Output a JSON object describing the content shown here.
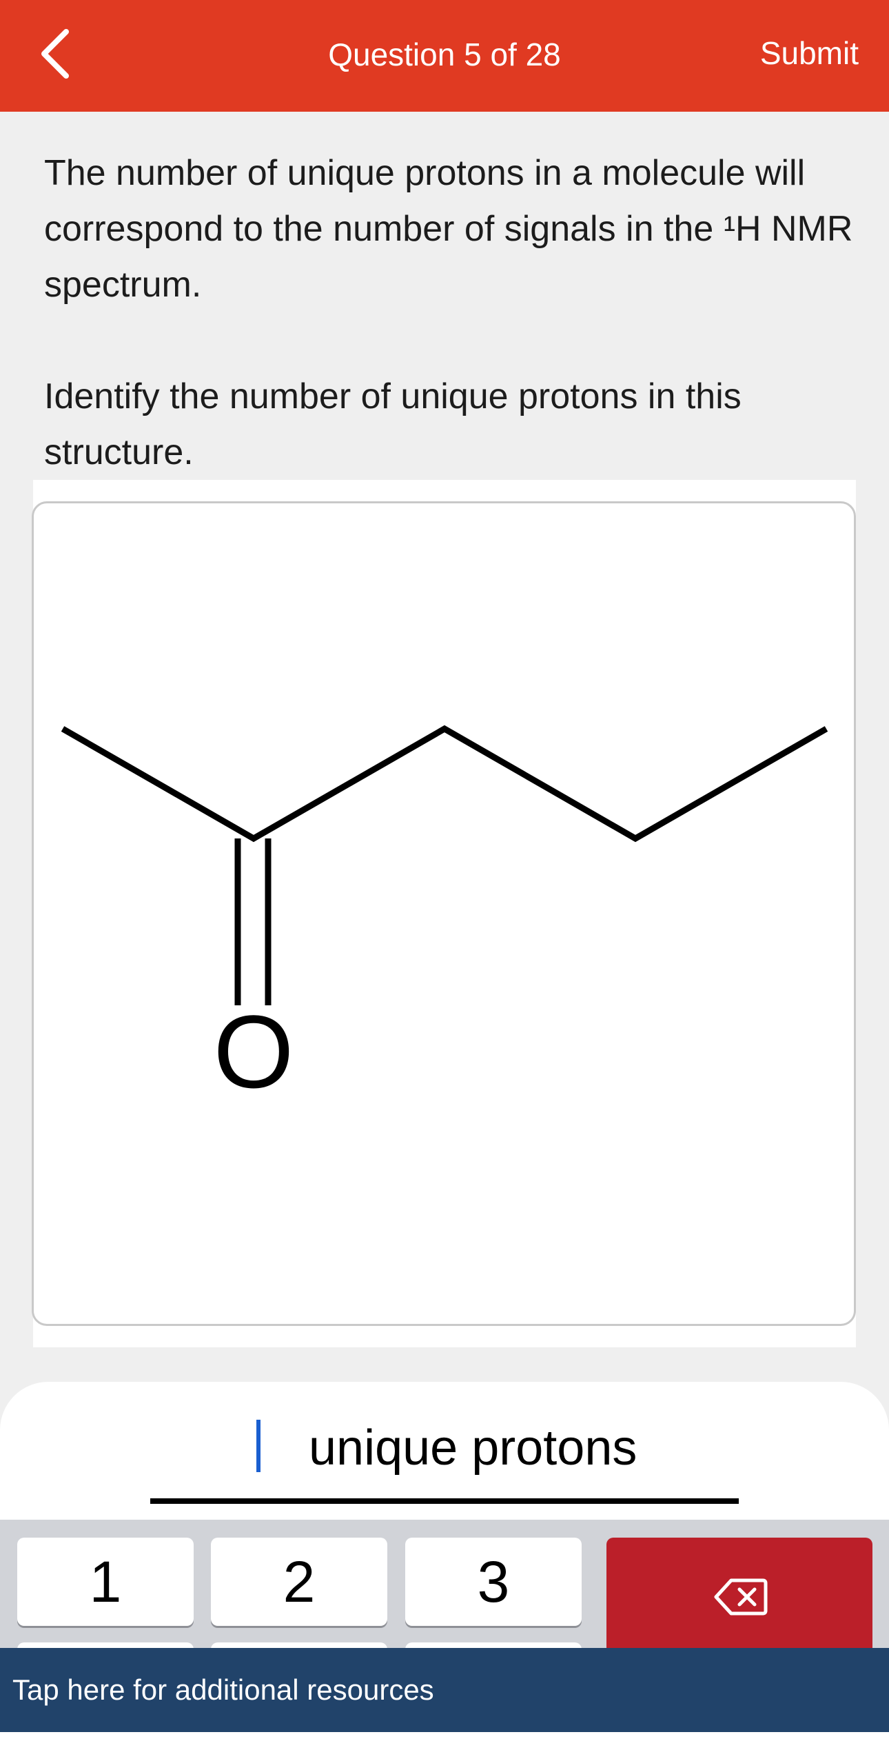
{
  "header": {
    "title": "Question 5 of 28",
    "submit_label": "Submit",
    "back_icon": "chevron-left-icon"
  },
  "question": {
    "paragraph_1": "The number of unique protons in a molecule will correspond to the number of signals in the ¹H NMR spectrum.",
    "paragraph_2": "Identify the number of unique protons in this structure."
  },
  "structure": {
    "atom_label": "O"
  },
  "answer": {
    "value": "",
    "unit": "unique protons"
  },
  "keypad": {
    "keys": [
      "1",
      "2",
      "3"
    ],
    "delete_icon": "backspace-icon"
  },
  "footer": {
    "resources_label": "Tap here for additional resources"
  },
  "colors": {
    "header": "#e03a22",
    "delete_key": "#bb1f29",
    "resources_bar": "#21436a",
    "caret": "#1a5fd0"
  }
}
